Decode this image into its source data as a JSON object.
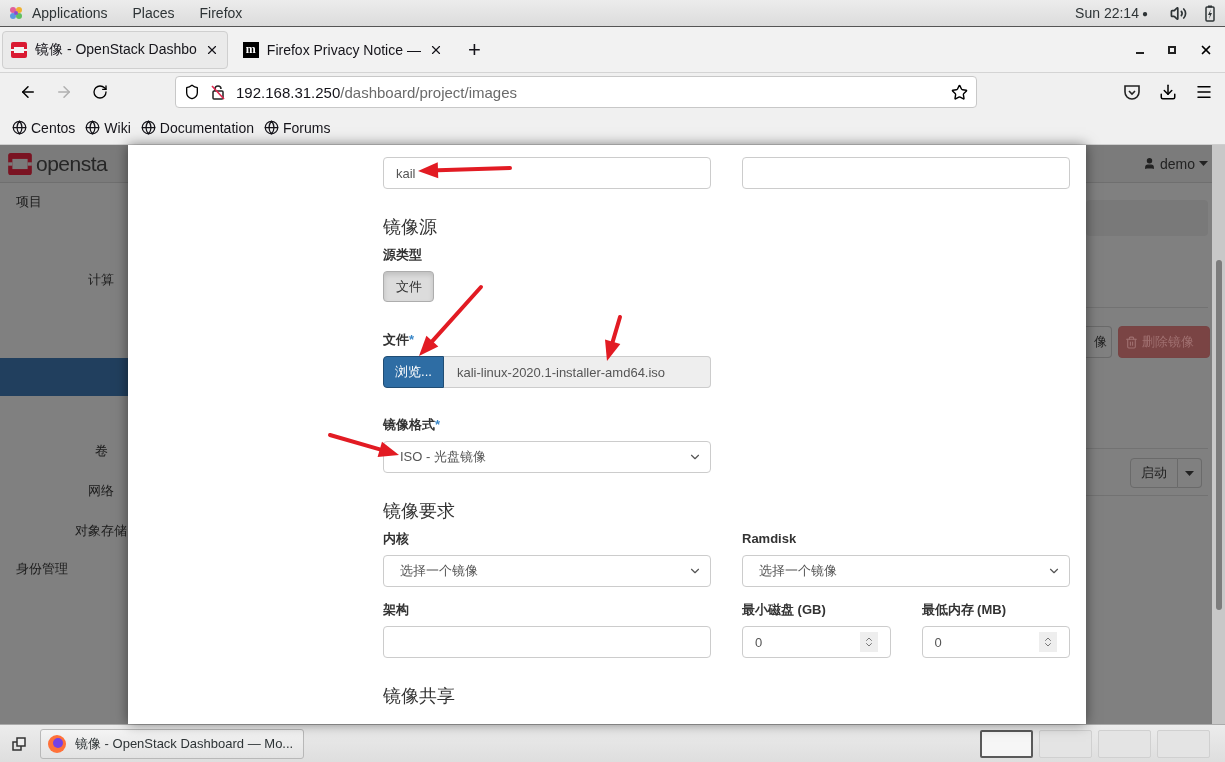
{
  "top_bar": {
    "menus": [
      "Applications",
      "Places",
      "Firefox"
    ],
    "clock": "Sun 22:14",
    "dot": "●"
  },
  "browser": {
    "tabs": [
      {
        "kind": "openstack",
        "title": "镜像 - OpenStack Dashbo",
        "selected": true
      },
      {
        "kind": "letter",
        "icon_text": "m",
        "title": "Firefox Privacy Notice —",
        "selected": false
      }
    ],
    "new_tab": "+",
    "forward_disabled": true,
    "url_host": "192.168.31.250",
    "url_path": "/dashboard/project/images",
    "bookmarks": [
      "Centos",
      "Wiki",
      "Documentation",
      "Forums"
    ]
  },
  "dashboard": {
    "logo_text": "opensta",
    "user": "demo",
    "sidebar": [
      {
        "kind": "group",
        "label": "项目",
        "selected": false
      },
      {
        "kind": "sub",
        "label": "计算",
        "selected": false
      },
      {
        "kind": "sub",
        "selected": true
      },
      {
        "kind": "sub",
        "label": "卷",
        "selected": false
      },
      {
        "kind": "sub",
        "label": "网络",
        "selected": false
      },
      {
        "kind": "sub",
        "label": "对象存储",
        "selected": false
      },
      {
        "kind": "group",
        "label": "身份管理",
        "selected": false
      }
    ],
    "buttons": [
      {
        "kind": "default",
        "label": "像"
      },
      {
        "kind": "danger",
        "label": "删除镜像"
      }
    ],
    "launch": "启动"
  },
  "modal": {
    "name_value": "kail",
    "source_heading": "镜像源",
    "source_type_label": "源类型",
    "source_type_button": {
      "label": "文件",
      "selected": true
    },
    "file_label": "文件",
    "file_required": "*",
    "browse_button": "浏览...",
    "file_name": "kali-linux-2020.1-installer-amd64.iso",
    "format_label": "镜像格式",
    "format_required": "*",
    "format_value": "ISO - 光盘镜像",
    "requirements_heading": "镜像要求",
    "kernel_label": "内核",
    "kernel_value": "选择一个镜像",
    "ramdisk_label": "Ramdisk",
    "ramdisk_value": "选择一个镜像",
    "arch_label": "架构",
    "min_disk_label": "最小磁盘 (GB)",
    "min_disk_value": "0",
    "min_ram_label": "最低内存 (MB)",
    "min_ram_value": "0",
    "sharing_heading": "镜像共享"
  },
  "taskbar": {
    "task": "镜像 - OpenStack Dashboard — Mo...",
    "workspaces": [
      {
        "selected": true
      },
      {
        "selected": false
      },
      {
        "selected": false
      },
      {
        "selected": false
      }
    ]
  }
}
